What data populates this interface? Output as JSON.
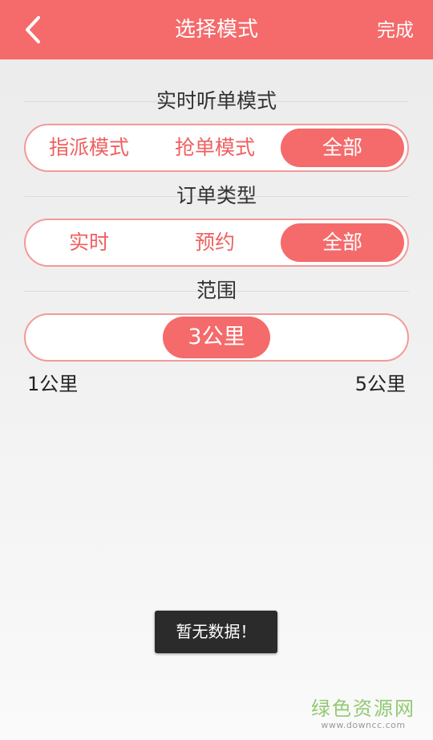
{
  "header": {
    "title": "选择模式",
    "done_label": "完成",
    "back_icon": "chevron-left-icon",
    "background_color": "#f56a6a"
  },
  "listen_mode": {
    "title": "实时听单模式",
    "options": [
      "指派模式",
      "抢单模式",
      "全部"
    ],
    "selected": "全部"
  },
  "order_type": {
    "title": "订单类型",
    "options": [
      "实时",
      "预约",
      "全部"
    ],
    "selected": "全部"
  },
  "range": {
    "title": "范围",
    "min_label": "1公里",
    "max_label": "5公里",
    "current_label": "3公里",
    "fraction": 0.5
  },
  "toast": {
    "message": "暂无数据！"
  },
  "watermark": {
    "title": "绿色资源网",
    "url": "www.downcc.com"
  }
}
